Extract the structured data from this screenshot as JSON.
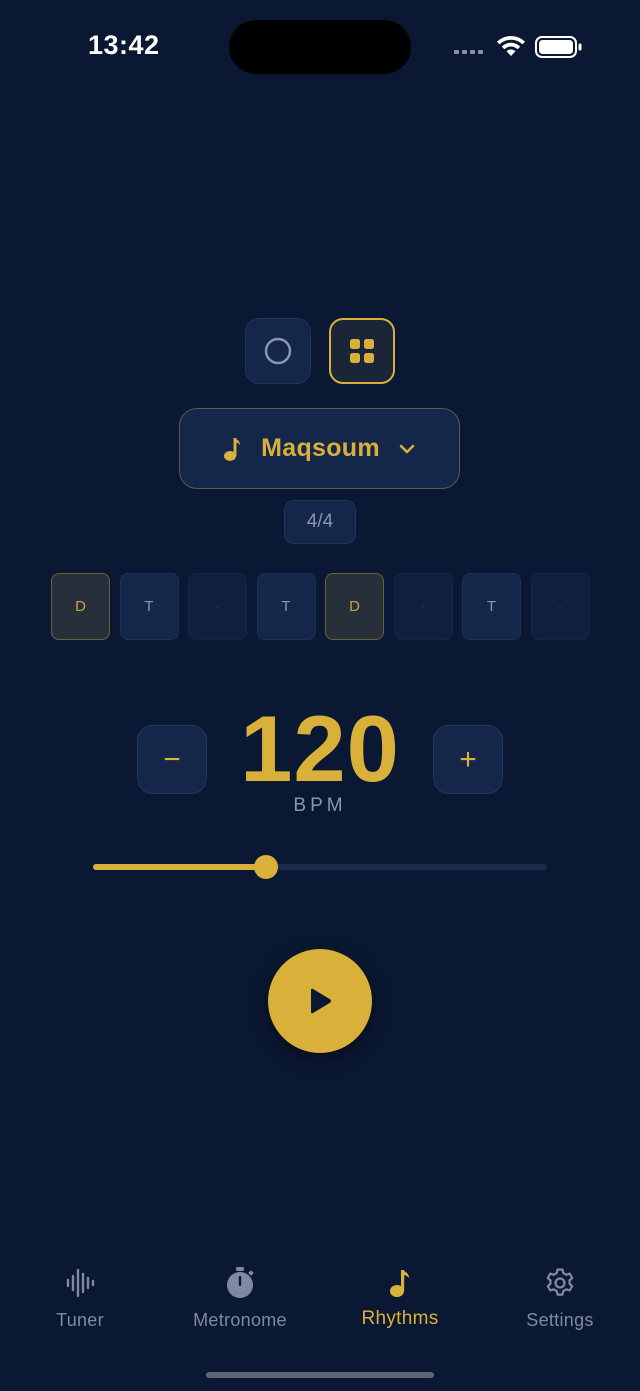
{
  "status_bar": {
    "time": "13:42"
  },
  "mode_toggle": {
    "active": "grid"
  },
  "rhythm": {
    "name": "Maqsoum",
    "time_signature": "4/4"
  },
  "beats": [
    {
      "label": "D",
      "type": "dum"
    },
    {
      "label": "T",
      "type": "tak"
    },
    {
      "label": "·",
      "type": "rest"
    },
    {
      "label": "T",
      "type": "tak"
    },
    {
      "label": "D",
      "type": "dum"
    },
    {
      "label": "·",
      "type": "rest"
    },
    {
      "label": "T",
      "type": "tak"
    },
    {
      "label": "·",
      "type": "rest"
    }
  ],
  "tempo": {
    "minus_label": "−",
    "plus_label": "+",
    "bpm": "120",
    "unit": "BPM",
    "slider_fraction": 0.38
  },
  "tabs": [
    {
      "label": "Tuner",
      "icon": "waveform-icon"
    },
    {
      "label": "Metronome",
      "icon": "stopwatch-icon"
    },
    {
      "label": "Rhythms",
      "icon": "music-note-icon"
    },
    {
      "label": "Settings",
      "icon": "gear-icon"
    }
  ],
  "colors": {
    "accent": "#d9b13a",
    "background": "#0b1833",
    "card": "#14264a",
    "muted": "#8a96ae"
  }
}
